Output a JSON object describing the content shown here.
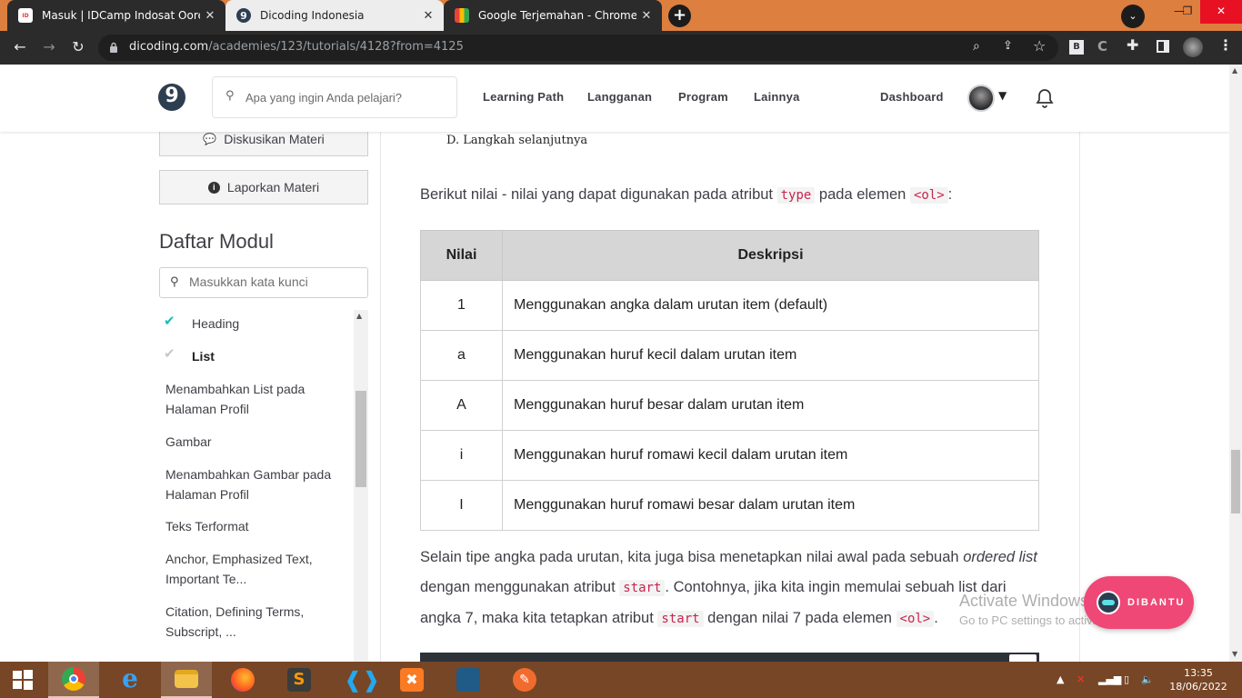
{
  "browser": {
    "tabs": [
      {
        "title": "Masuk | IDCamp Indosat Ooredoo",
        "close": "✕",
        "active": false
      },
      {
        "title": "Dicoding Indonesia",
        "close": "✕",
        "active": true
      },
      {
        "title": "Google Terjemahan - Chrome Web Store",
        "close": "✕",
        "active": false
      }
    ],
    "new_tab": "+",
    "window_controls": {
      "minimize": "—",
      "maximize": "❐",
      "close": "✕"
    },
    "url_domain": "dicoding.com",
    "url_path": "/academies/123/tutorials/4128?from=4125"
  },
  "header": {
    "logo": "9",
    "search_placeholder": "Apa yang ingin Anda pelajari?",
    "nav": [
      "Learning Path",
      "Langganan",
      "Program",
      "Lainnya"
    ],
    "dashboard": "Dashboard"
  },
  "sidebar": {
    "discussion_button": "Diskusikan Materi",
    "report_button": "Laporkan Materi",
    "module_title": "Daftar Modul",
    "module_search_placeholder": "Masukkan kata kunci",
    "modules": [
      {
        "label": "Heading",
        "done": true
      },
      {
        "label": "List",
        "done": true
      },
      {
        "label": "Menambahkan List pada Halaman Profil"
      },
      {
        "label": "Gambar"
      },
      {
        "label": "Menambahkan Gambar pada Halaman Profil"
      },
      {
        "label": "Teks Terformat"
      },
      {
        "label": "Anchor, Emphasized Text, Important Te..."
      },
      {
        "label": "Citation, Defining Terms, Subscript, ..."
      }
    ]
  },
  "content": {
    "image_snippet": "D. Langkah selanjutnya",
    "intro": {
      "before": "Berikut nilai - nilai yang dapat digunakan pada atribut",
      "code1": "type",
      "middle": "pada elemen",
      "code2": "<ol>",
      "after": ":"
    },
    "table": {
      "headers": [
        "Nilai",
        "Deskripsi"
      ],
      "rows": [
        {
          "value": "1",
          "desc": "Menggunakan angka dalam urutan item (default)"
        },
        {
          "value": "a",
          "desc": "Menggunakan huruf kecil dalam urutan item"
        },
        {
          "value": "A",
          "desc": "Menggunakan huruf besar dalam urutan item"
        },
        {
          "value": "i",
          "desc": "Menggunakan huruf romawi kecil dalam urutan item"
        },
        {
          "value": "I",
          "desc": "Menggunakan huruf romawi besar dalam urutan item"
        }
      ]
    },
    "paragraph2": {
      "part1": "Selain tipe angka pada urutan, kita juga bisa menetapkan nilai awal pada sebuah",
      "em": "ordered list",
      "part2": "dengan menggunakan atribut",
      "code1": "start",
      "part3": ". Contohnya, jika kita ingin memulai sebuah list dari angka 7, maka kita tetapkan atribut",
      "code2": "start",
      "part4": "dengan nilai 7 pada elemen",
      "code3": "<ol>",
      "part5": "."
    }
  },
  "overlay": {
    "activate_title": "Activate Windows",
    "activate_sub": "Go to PC settings to activate Windows.",
    "help_button": "DIBANTU"
  },
  "taskbar": {
    "time": "13:35",
    "date": "18/06/2022"
  }
}
